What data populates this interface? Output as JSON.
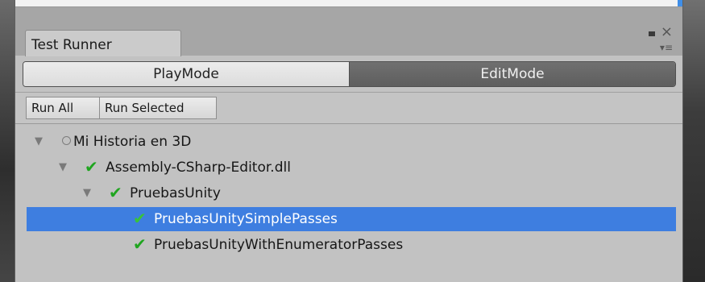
{
  "window": {
    "tab_title": "Test Runner",
    "close_glyph": "×",
    "menu_glyph": "▾≡"
  },
  "modes": {
    "playmode_label": "PlayMode",
    "editmode_label": "EditMode",
    "active": "EditMode"
  },
  "toolbar": {
    "run_all_label": "Run All",
    "run_selected_label": "Run Selected"
  },
  "tree": {
    "items": [
      {
        "label": "Mi Historia en 3D",
        "status": "not-run",
        "expanded": true,
        "depth": 0
      },
      {
        "label": "Assembly-CSharp-Editor.dll",
        "status": "passed",
        "expanded": true,
        "depth": 1
      },
      {
        "label": "PruebasUnity",
        "status": "passed",
        "expanded": true,
        "depth": 2
      },
      {
        "label": "PruebasUnitySimplePasses",
        "status": "passed",
        "selected": true,
        "depth": 3
      },
      {
        "label": "PruebasUnityWithEnumeratorPasses",
        "status": "passed",
        "depth": 3
      }
    ],
    "arrow_glyph": "▼",
    "check_glyph": "✔"
  },
  "colors": {
    "selection": "#3e7ee0",
    "pass": "#1fa51f",
    "active_mode": "#656565"
  }
}
